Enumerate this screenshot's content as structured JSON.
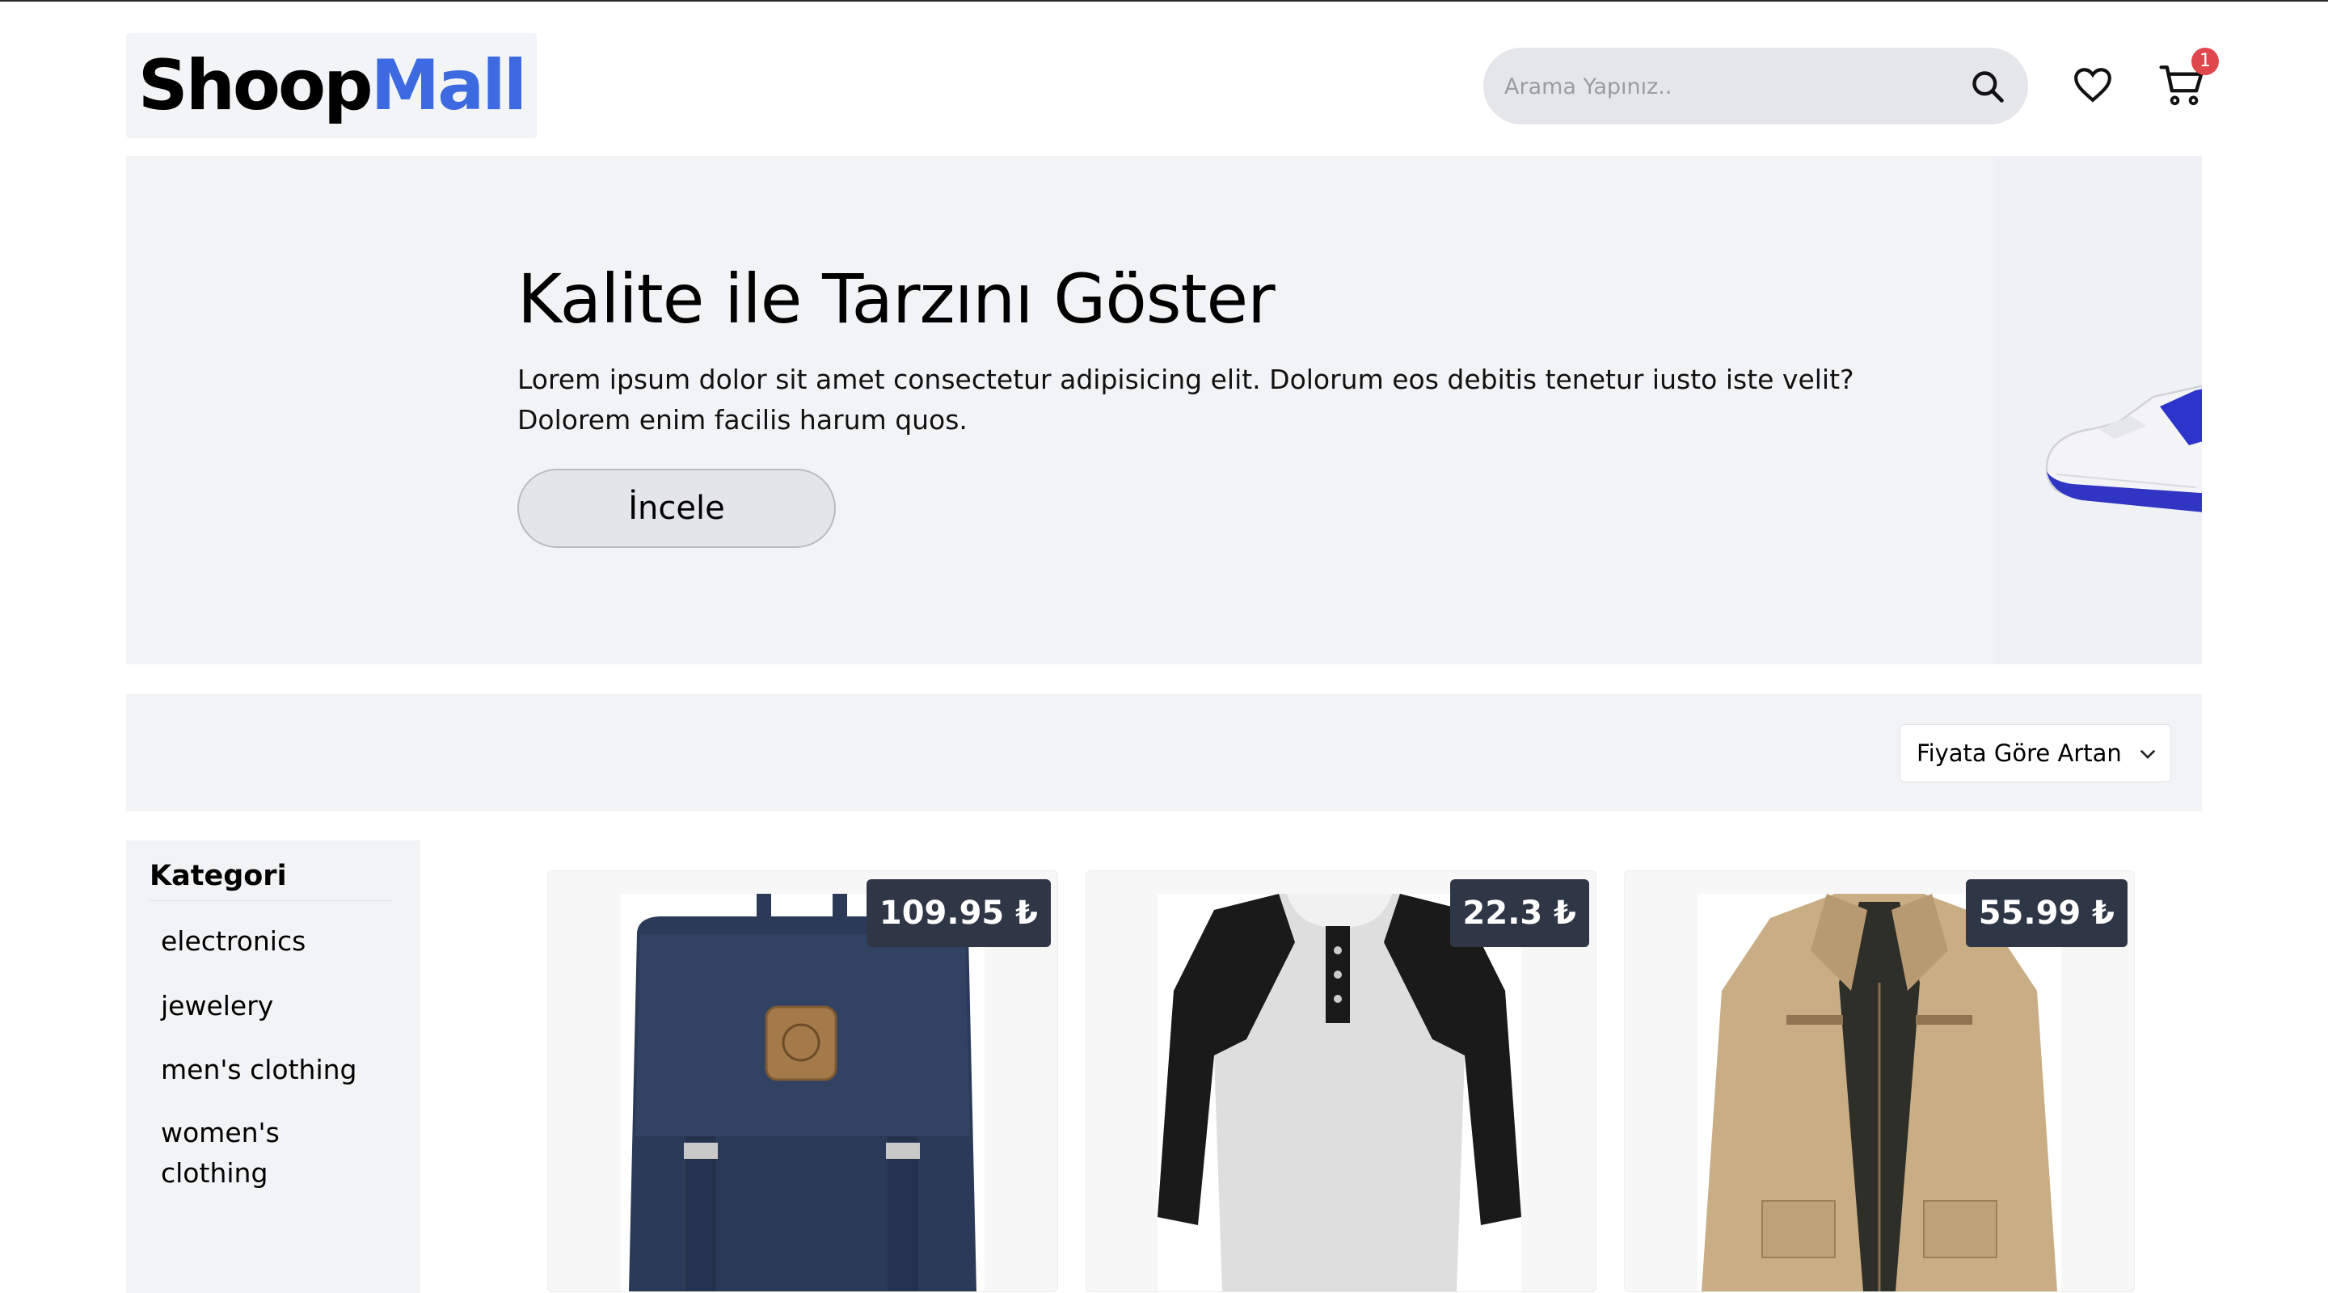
{
  "header": {
    "logo_part1": "Shoop",
    "logo_part2": "Mall",
    "search_placeholder": "Arama Yapınız..",
    "cart_count": "1",
    "icons": [
      "search-icon",
      "heart-icon",
      "cart-icon"
    ]
  },
  "hero": {
    "title": "Kalite ile Tarzını Göster",
    "description": "Lorem ipsum dolor sit amet consectetur adipisicing elit. Dolorum eos debitis tenetur iusto iste velit? Dolorem enim facilis harum quos.",
    "button_label": "İncele"
  },
  "filter": {
    "sort_selected": "Fiyata Göre Artan"
  },
  "sidebar": {
    "title": "Kategori",
    "categories": [
      "electronics",
      "jewelery",
      "men's clothing",
      "women's clothing"
    ]
  },
  "products": [
    {
      "price": "109.95 ₺"
    },
    {
      "price": "22.3 ₺"
    },
    {
      "price": "55.99 ₺"
    }
  ],
  "colors": {
    "brand_accent": "#3d6ae0",
    "price_badge": "#2f3747",
    "cart_badge": "#e0474c",
    "panel": "#f2f3f5"
  }
}
